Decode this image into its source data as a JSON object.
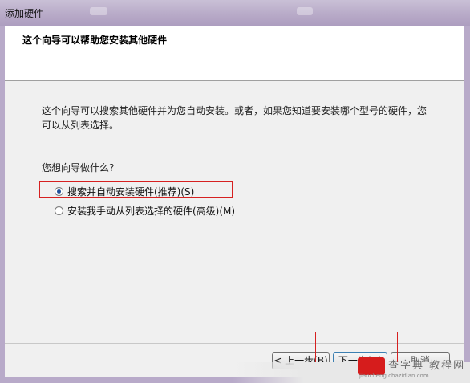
{
  "window": {
    "title": "添加硬件"
  },
  "header": {
    "heading": "这个向导可以帮助您安装其他硬件"
  },
  "body": {
    "description_line1": "这个向导可以搜索其他硬件并为您自动安装。或者，如果您知道要安装哪个型号的硬件，您",
    "description_line2": "可以从列表选择。",
    "question": "您想向导做什么?"
  },
  "options": [
    {
      "label": "搜索并自动安装硬件(推荐)(S)",
      "selected": true
    },
    {
      "label": "安装我手动从列表选择的硬件(高级)(M)",
      "selected": false
    }
  ],
  "buttons": {
    "back": "< 上一步(B)",
    "next": "下一步(N)",
    "cancel": "取消"
  },
  "watermark": {
    "text": "查字典 教程网",
    "url": "jiaocheng.chazidian.com"
  },
  "colors": {
    "highlight": "#d62020",
    "radio_dot": "#1f4f9a"
  }
}
